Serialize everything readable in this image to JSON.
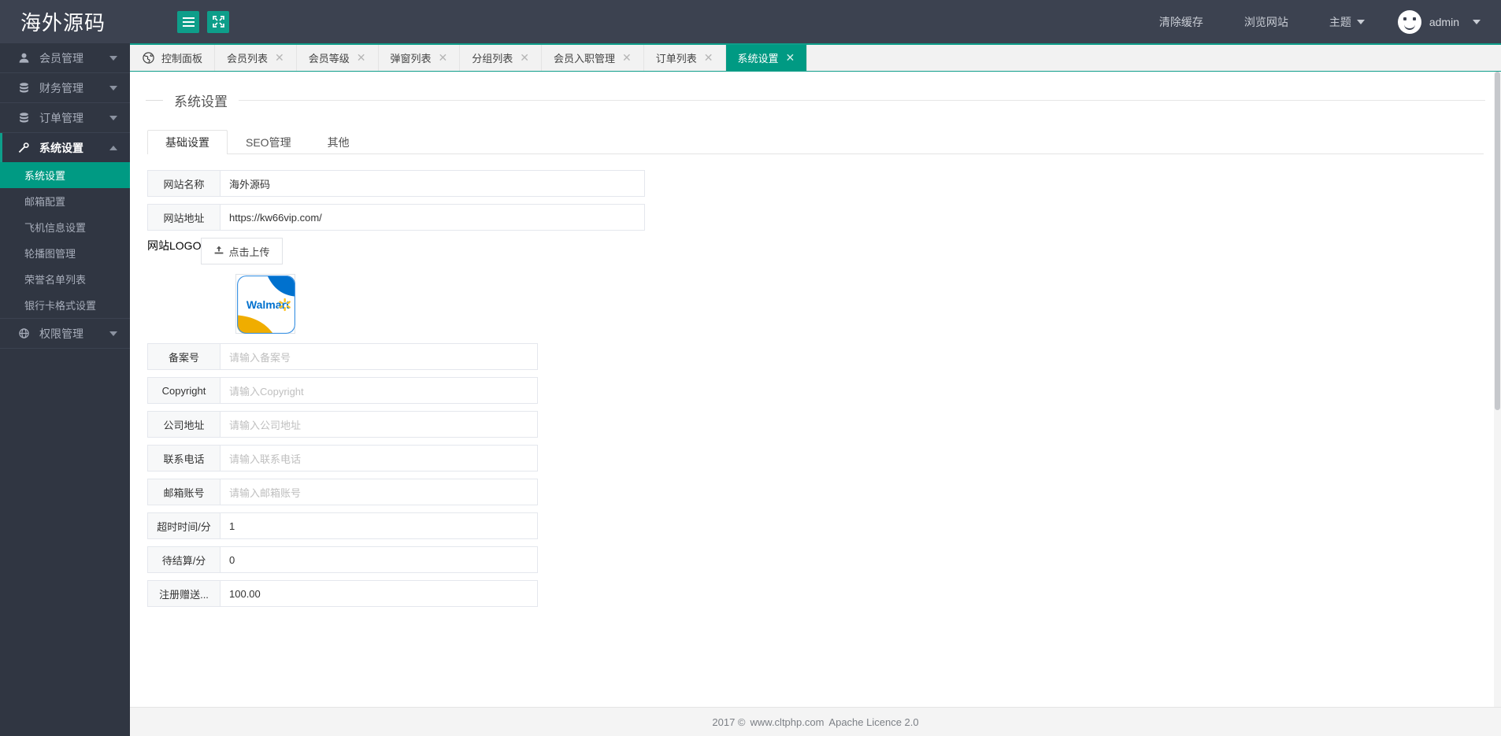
{
  "header": {
    "logo_text": "海外源码",
    "menu_toggle_icon": "hamburger-icon",
    "fullscreen_icon": "expand-icon",
    "links": [
      {
        "label": "清除缓存",
        "name": "clear-cache"
      },
      {
        "label": "浏览网站",
        "name": "browse-site"
      },
      {
        "label": "主题",
        "name": "theme",
        "caret": true
      }
    ],
    "user": {
      "name": "admin",
      "avatar_icon": "smiley-avatar-icon"
    }
  },
  "sidebar": {
    "groups": [
      {
        "label": "会员管理",
        "icon": "user-icon",
        "expanded": false,
        "active": false,
        "children": []
      },
      {
        "label": "财务管理",
        "icon": "database-icon",
        "expanded": false,
        "active": false,
        "children": []
      },
      {
        "label": "订单管理",
        "icon": "database-icon",
        "expanded": false,
        "active": false,
        "children": []
      },
      {
        "label": "系统设置",
        "icon": "wrench-icon",
        "expanded": true,
        "active": true,
        "children": [
          {
            "label": "系统设置",
            "active": true
          },
          {
            "label": "邮箱配置",
            "active": false
          },
          {
            "label": "飞机信息设置",
            "active": false
          },
          {
            "label": "轮播图管理",
            "active": false
          },
          {
            "label": "荣誉名单列表",
            "active": false
          },
          {
            "label": "银行卡格式设置",
            "active": false
          }
        ]
      },
      {
        "label": "权限管理",
        "icon": "globe-icon",
        "expanded": false,
        "active": false,
        "children": []
      }
    ]
  },
  "tabbar": {
    "tabs": [
      {
        "label": "控制面板",
        "icon": "globe-icon",
        "closable": false,
        "active": false
      },
      {
        "label": "会员列表",
        "closable": true,
        "active": false
      },
      {
        "label": "会员等级",
        "closable": true,
        "active": false
      },
      {
        "label": "弹窗列表",
        "closable": true,
        "active": false
      },
      {
        "label": "分组列表",
        "closable": true,
        "active": false
      },
      {
        "label": "会员入职管理",
        "closable": true,
        "active": false
      },
      {
        "label": "订单列表",
        "closable": true,
        "active": false
      },
      {
        "label": "系统设置",
        "closable": true,
        "active": true
      }
    ],
    "close_glyph": "✕"
  },
  "page": {
    "title": "系统设置",
    "subtabs": [
      {
        "label": "基础设置",
        "active": true
      },
      {
        "label": "SEO管理",
        "active": false
      },
      {
        "label": "其他",
        "active": false
      }
    ],
    "fields": [
      {
        "label": "网站名称",
        "value": "海外源码",
        "placeholder": "",
        "width": "wide"
      },
      {
        "label": "网站地址",
        "value": "https://kw66vip.com/",
        "placeholder": "",
        "width": "wide"
      }
    ],
    "logo_row": {
      "label": "网站LOGO",
      "upload_label": "点击上传",
      "upload_icon": "upload-icon",
      "preview_alt": "Walmart"
    },
    "fields2": [
      {
        "label": "备案号",
        "value": "",
        "placeholder": "请输入备案号",
        "width": "mid"
      },
      {
        "label": "Copyright",
        "value": "",
        "placeholder": "请输入Copyright",
        "width": "mid"
      },
      {
        "label": "公司地址",
        "value": "",
        "placeholder": "请输入公司地址",
        "width": "mid"
      },
      {
        "label": "联系电话",
        "value": "",
        "placeholder": "请输入联系电话",
        "width": "mid"
      },
      {
        "label": "邮箱账号",
        "value": "",
        "placeholder": "请输入邮箱账号",
        "width": "mid"
      },
      {
        "label": "超时时间/分",
        "value": "1",
        "placeholder": "",
        "width": "mid"
      },
      {
        "label": "待结算/分",
        "value": "0",
        "placeholder": "",
        "width": "mid"
      },
      {
        "label": "注册赠送...",
        "value": "100.00",
        "placeholder": "",
        "width": "mid"
      }
    ]
  },
  "footer": {
    "year": "2017 ©",
    "site": "www.cltphp.com",
    "licence": "Apache Licence 2.0"
  },
  "colors": {
    "accent": "#0e9e8a",
    "accent_dark": "#009a83",
    "sidebar_bg": "#303642",
    "header_bg": "#3c4250"
  }
}
